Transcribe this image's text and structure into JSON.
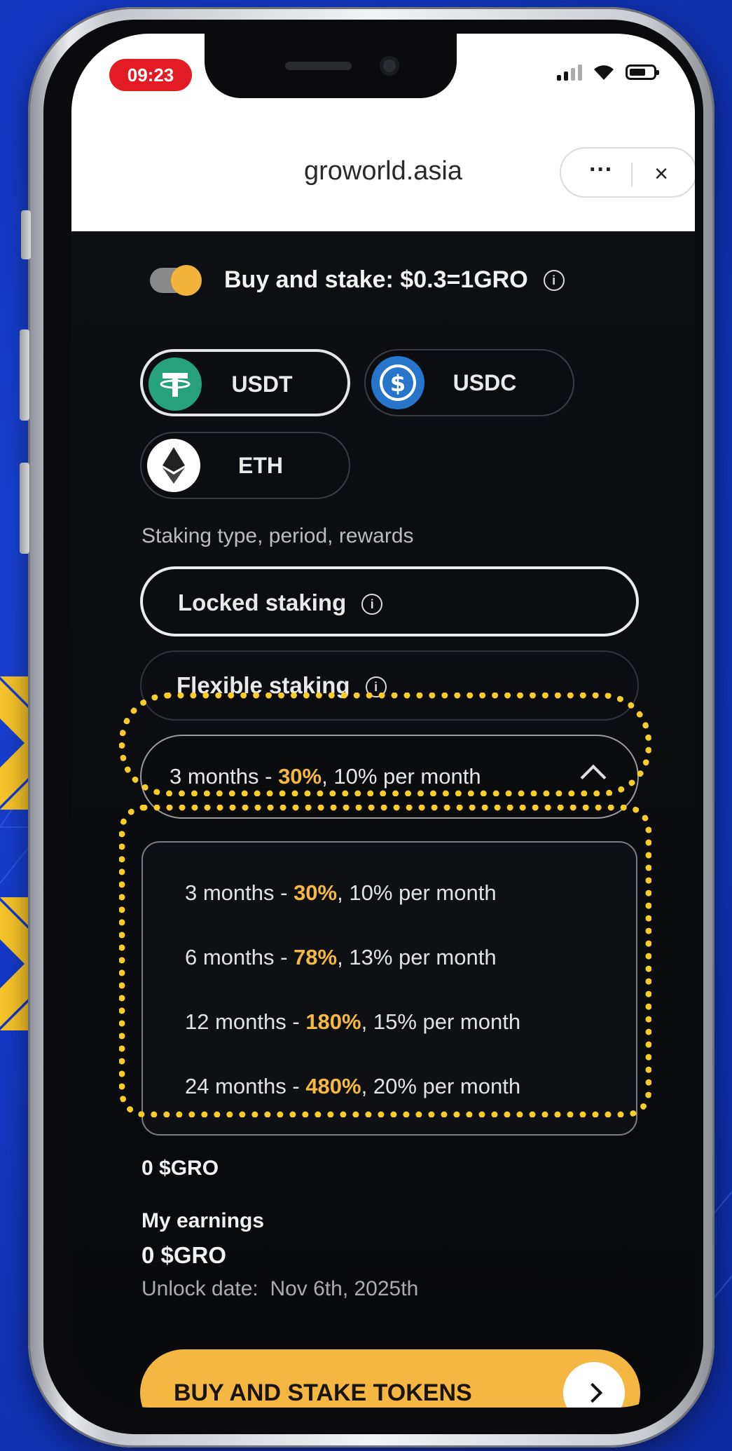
{
  "status_bar": {
    "time": "09:23"
  },
  "browser": {
    "url": "groworld.asia",
    "more_label": "···",
    "close_label": "×"
  },
  "buy_stake_toggle": {
    "label": "Buy and stake: $0.3=1GRO",
    "enabled": true
  },
  "tokens": [
    {
      "label": "USDT",
      "icon": "tether-icon",
      "selected": true
    },
    {
      "label": "USDC",
      "icon": "usdc-icon",
      "selected": false
    },
    {
      "label": "ETH",
      "icon": "ethereum-icon",
      "selected": false
    }
  ],
  "staking": {
    "section_label": "Staking type, period, rewards",
    "types": [
      {
        "label": "Locked staking",
        "selected": true
      },
      {
        "label": "Flexible staking",
        "selected": false
      }
    ],
    "selected_period": {
      "prefix": "3 months - ",
      "rate": "30%",
      "suffix": ", 10% per month"
    },
    "period_options": [
      {
        "prefix": "3 months - ",
        "rate": "30%",
        "suffix": ", 10% per month"
      },
      {
        "prefix": "6 months - ",
        "rate": "78%",
        "suffix": ", 13% per month"
      },
      {
        "prefix": "12 months - ",
        "rate": "180%",
        "suffix": ", 15% per month"
      },
      {
        "prefix": "24 months - ",
        "rate": "480%",
        "suffix": ", 20% per month"
      }
    ]
  },
  "balance": {
    "value": "0 $GRO"
  },
  "earnings": {
    "title": "My earnings",
    "value": "0 $GRO",
    "unlock_label": "Unlock date:",
    "unlock_date": "Nov 6th, 2025th"
  },
  "cta": {
    "label": "BUY AND STAKE TOKENS"
  },
  "colors": {
    "background": "#1438c6",
    "accent": "#f4b842",
    "highlight_box": "#f7cd2c",
    "error_pill": "#e21b24"
  }
}
